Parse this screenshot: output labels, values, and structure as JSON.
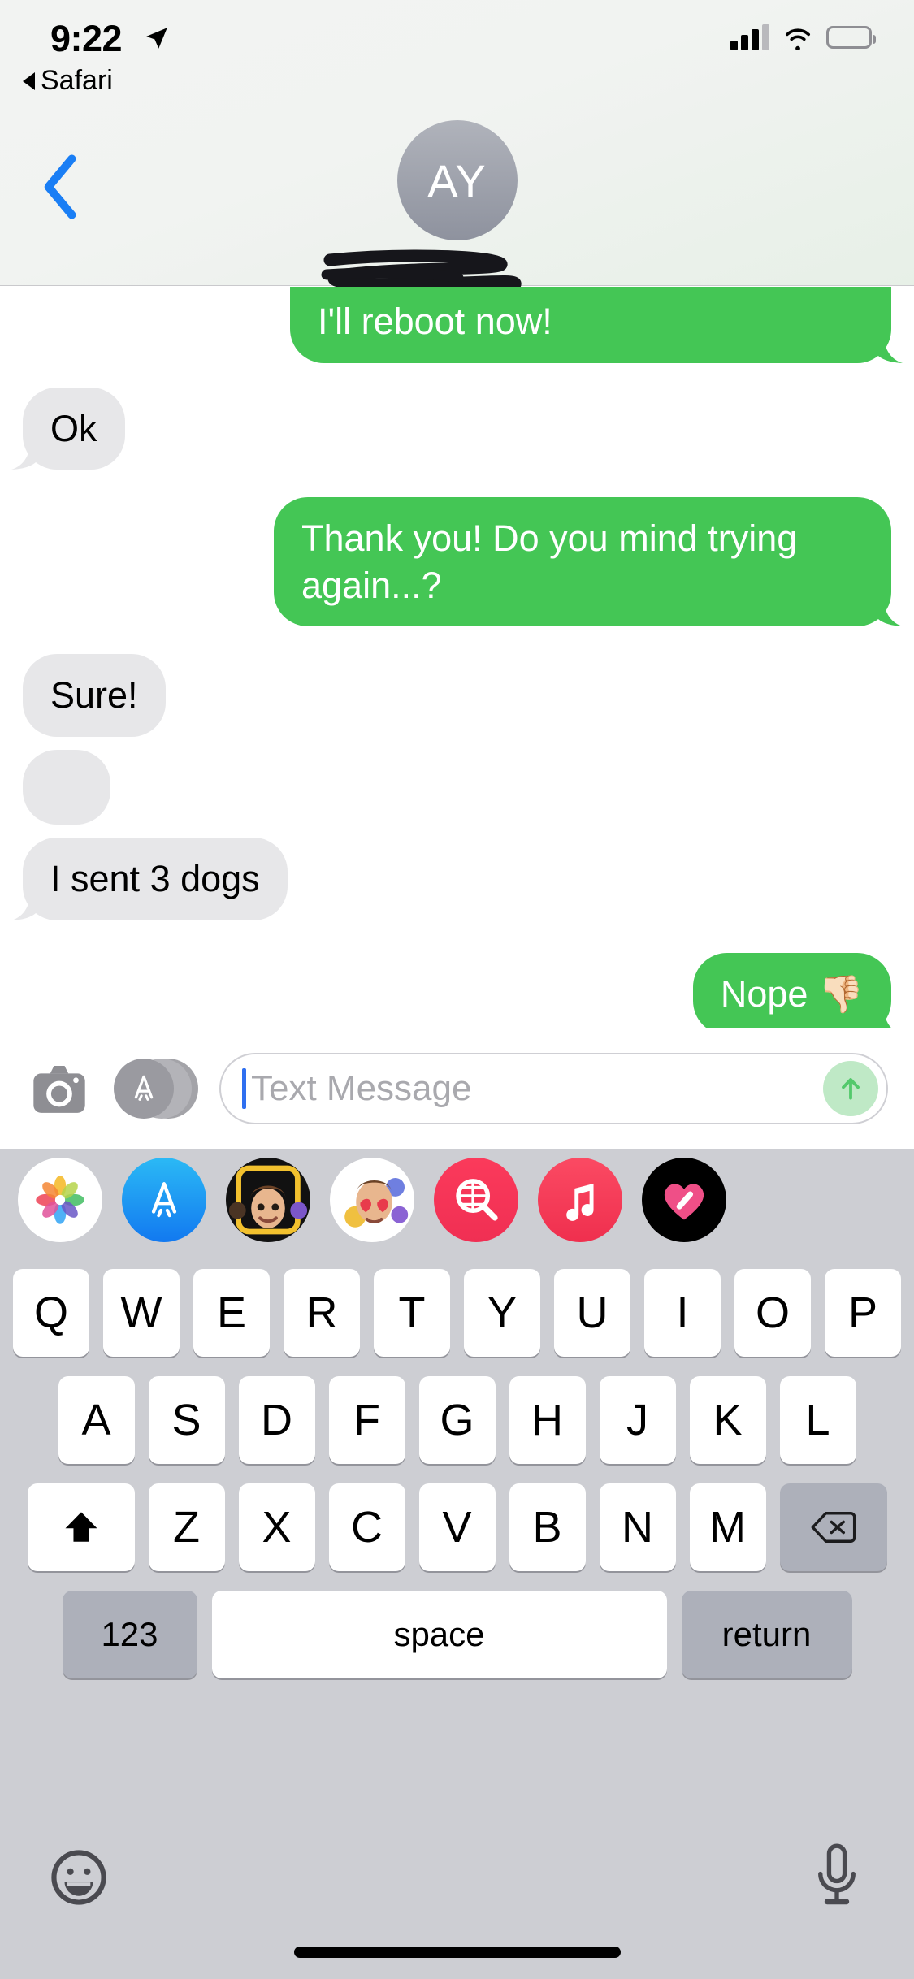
{
  "status_bar": {
    "time": "9:22",
    "location_icon": "location-arrow-icon",
    "back_app_label": "Safari",
    "signal_icon": "cellular-signal-icon",
    "wifi_icon": "wifi-icon",
    "battery_icon": "battery-icon"
  },
  "header": {
    "back_icon": "chevron-left-icon",
    "avatar_initials": "AY",
    "contact_name_redacted": "",
    "redaction_note": "scribble-redaction"
  },
  "thread": {
    "messages": [
      {
        "id": "m1",
        "side": "out",
        "text": "I'll reboot now!",
        "clipped_top": true,
        "empty": false
      },
      {
        "id": "m2",
        "side": "in",
        "text": "Ok",
        "clipped_top": false,
        "empty": false
      },
      {
        "id": "m3",
        "side": "out",
        "text": "Thank you! Do you mind trying again...?",
        "clipped_top": false,
        "empty": false
      },
      {
        "id": "m4",
        "side": "in",
        "text": "Sure!",
        "clipped_top": false,
        "empty": false
      },
      {
        "id": "m5",
        "side": "in",
        "text": "",
        "clipped_top": false,
        "empty": true
      },
      {
        "id": "m6",
        "side": "in",
        "text": "I sent 3 dogs",
        "clipped_top": false,
        "empty": false
      },
      {
        "id": "m7",
        "side": "out",
        "text": "Nope 👎🏻",
        "clipped_top": false,
        "empty": false
      }
    ],
    "bubble_colors": {
      "outgoing": "#44c655",
      "incoming": "#e7e7e9"
    }
  },
  "input_bar": {
    "camera_icon": "camera-icon",
    "appstore_icon": "app-store-icon",
    "placeholder": "Text Message",
    "value": "",
    "send_icon": "send-arrow-up-icon"
  },
  "app_drawer": {
    "apps": [
      {
        "name": "photos-app-icon",
        "label": "Photos"
      },
      {
        "name": "app-store-app-icon",
        "label": "App Store"
      },
      {
        "name": "memoji-app-icon",
        "label": "Memoji"
      },
      {
        "name": "memoji-stickers-app-icon",
        "label": "Memoji Stickers"
      },
      {
        "name": "images-search-app-icon",
        "label": "#images"
      },
      {
        "name": "music-app-icon",
        "label": "Music"
      },
      {
        "name": "digital-touch-app-icon",
        "label": "Digital Touch"
      }
    ]
  },
  "keyboard": {
    "row1": [
      "Q",
      "W",
      "E",
      "R",
      "T",
      "Y",
      "U",
      "I",
      "O",
      "P"
    ],
    "row2": [
      "A",
      "S",
      "D",
      "F",
      "G",
      "H",
      "J",
      "K",
      "L"
    ],
    "row3_letters": [
      "Z",
      "X",
      "C",
      "V",
      "B",
      "N",
      "M"
    ],
    "shift_icon": "shift-up-arrow-icon",
    "delete_icon": "delete-backspace-icon",
    "numbers_label": "123",
    "space_label": "space",
    "return_label": "return",
    "emoji_icon": "emoji-smiley-icon",
    "dictation_icon": "microphone-icon"
  }
}
